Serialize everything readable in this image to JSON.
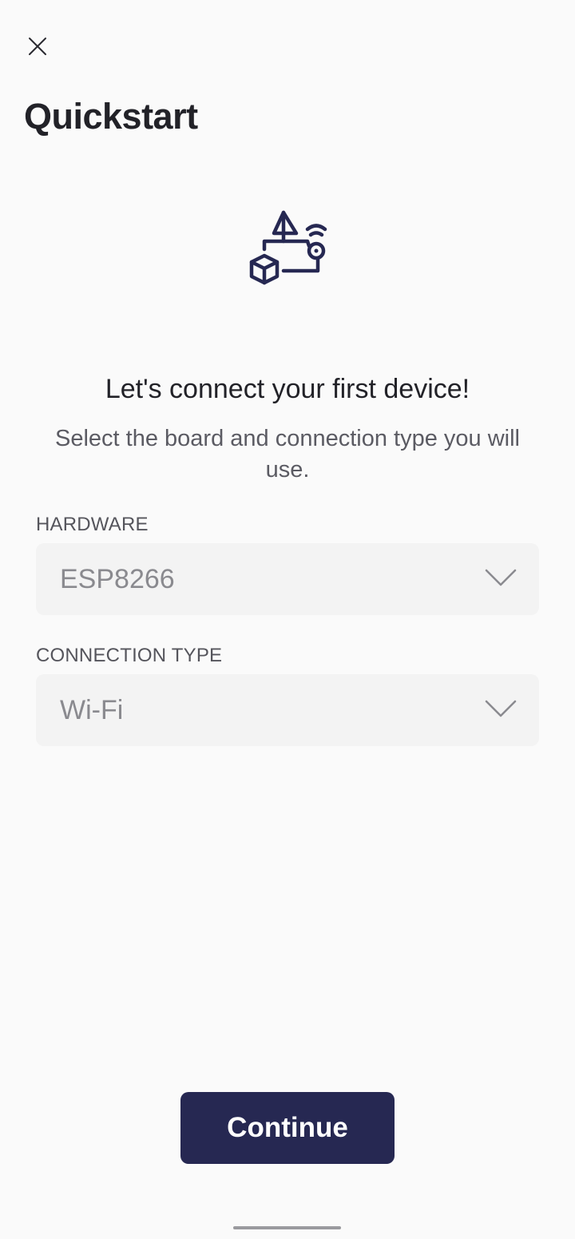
{
  "header": {
    "close_icon": "close-icon",
    "title": "Quickstart"
  },
  "hero": {
    "icon": "device-connection-icon",
    "icon_color": "#262852"
  },
  "intro": {
    "headline": "Let's connect your first device!",
    "subtitle": "Select the board and connection type you will use."
  },
  "form": {
    "hardware": {
      "label": "HARDWARE",
      "value": "ESP8266",
      "chevron_icon": "chevron-down-icon"
    },
    "connection_type": {
      "label": "CONNECTION TYPE",
      "value": "Wi-Fi",
      "chevron_icon": "chevron-down-icon"
    }
  },
  "footer": {
    "continue_label": "Continue",
    "button_color": "#262852"
  }
}
